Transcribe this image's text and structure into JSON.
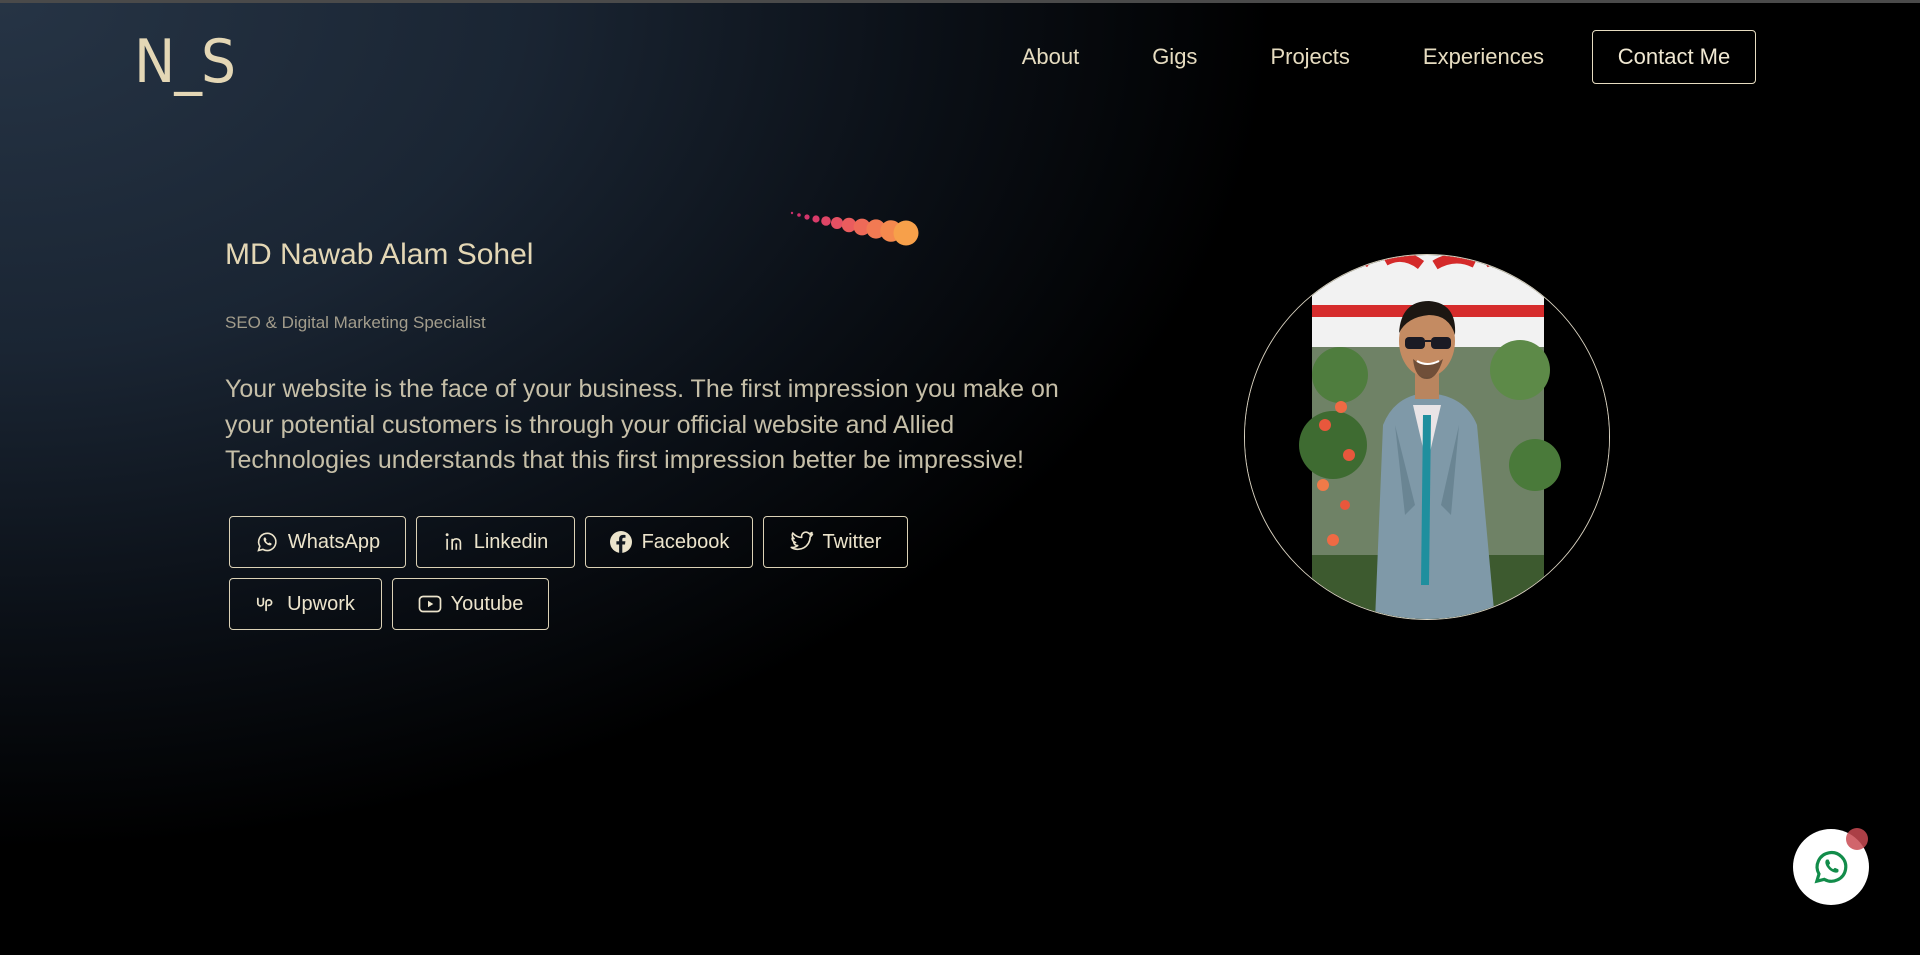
{
  "header": {
    "logo": "N_S",
    "nav": [
      "About",
      "Gigs",
      "Projects",
      "Experiences"
    ],
    "contact_label": "Contact Me"
  },
  "hero": {
    "name": "MD Nawab Alam Sohel",
    "role": "SEO & Digital Marketing Specialist",
    "tagline": "Your website is the face of your business. The first impression you make on your potential customers is through your official website and Allied Technologies understands that this first impression better be impressive!"
  },
  "socials": [
    {
      "label": "WhatsApp",
      "icon": "whatsapp-icon"
    },
    {
      "label": "Linkedin",
      "icon": "linkedin-icon"
    },
    {
      "label": "Facebook",
      "icon": "facebook-icon"
    },
    {
      "label": "Twitter",
      "icon": "twitter-icon"
    },
    {
      "label": "Upwork",
      "icon": "upwork-icon"
    },
    {
      "label": "Youtube",
      "icon": "youtube-icon"
    }
  ],
  "colors": {
    "accent_text": "#e4d7b5",
    "comet_start": "#d6336c",
    "comet_end": "#f7a04a",
    "whatsapp_green": "#128c4a"
  }
}
